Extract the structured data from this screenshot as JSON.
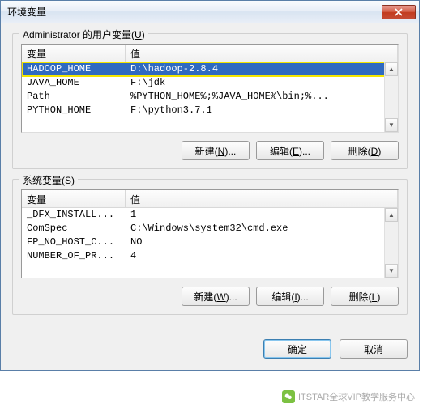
{
  "title": "环境变量",
  "user_vars": {
    "label": "Administrator 的用户变量",
    "accel": "U",
    "columns": {
      "var": "变量",
      "val": "值"
    },
    "rows": [
      {
        "var": "HADOOP_HOME",
        "val": "D:\\hadoop-2.8.4",
        "selected": true
      },
      {
        "var": "JAVA_HOME",
        "val": "F:\\jdk"
      },
      {
        "var": "Path",
        "val": "%PYTHON_HOME%;%JAVA_HOME%\\bin;%..."
      },
      {
        "var": "PYTHON_HOME",
        "val": "F:\\python3.7.1"
      }
    ],
    "buttons": {
      "new": "新建",
      "new_accel": "N",
      "edit": "编辑",
      "edit_accel": "E",
      "del": "删除",
      "del_accel": "D"
    }
  },
  "sys_vars": {
    "label": "系统变量",
    "accel": "S",
    "columns": {
      "var": "变量",
      "val": "值"
    },
    "rows": [
      {
        "var": "_DFX_INSTALL...",
        "val": "1"
      },
      {
        "var": "ComSpec",
        "val": "C:\\Windows\\system32\\cmd.exe"
      },
      {
        "var": "FP_NO_HOST_C...",
        "val": "NO"
      },
      {
        "var": "NUMBER_OF_PR...",
        "val": "4"
      }
    ],
    "buttons": {
      "new": "新建",
      "new_accel": "W",
      "edit": "编辑",
      "edit_accel": "I",
      "del": "删除",
      "del_accel": "L"
    }
  },
  "main_buttons": {
    "ok": "确定",
    "cancel": "取消"
  },
  "watermark": "ITSTAR全球VIP教学服务中心"
}
